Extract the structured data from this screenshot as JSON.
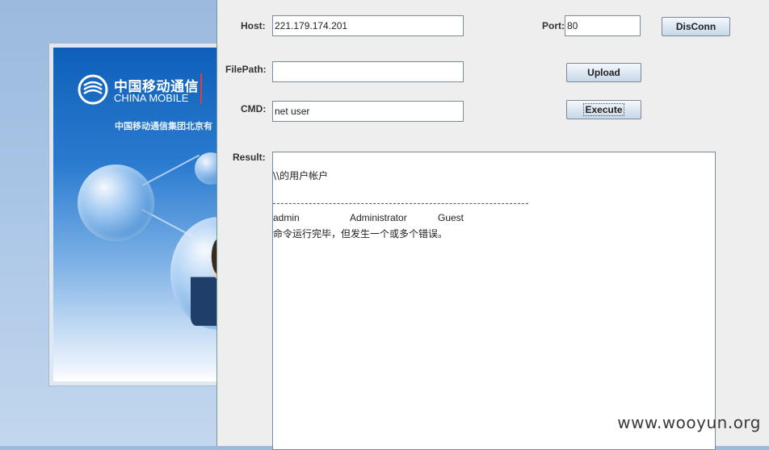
{
  "banner": {
    "logo_cn": "中国移动通信",
    "logo_en": "CHINA MOBILE",
    "subtitle": "中国移动通信集团北京有"
  },
  "form": {
    "host_label": "Host:",
    "host_value": "221.179.174.201",
    "port_label": "Port:",
    "port_value": "80",
    "disconn_label": "DisConn",
    "filepath_label": "FilePath:",
    "filepath_value": "",
    "upload_label": "Upload",
    "cmd_label": "CMD:",
    "cmd_value": "net user",
    "execute_label": "Execute",
    "result_label": "Result:"
  },
  "result": {
    "line1": "\\\\的用户帐户",
    "accounts": [
      "admin",
      "Administrator",
      "Guest"
    ],
    "footer": "命令运行完毕，但发生一个或多个错误。"
  },
  "watermark": "www.wooyun.org"
}
